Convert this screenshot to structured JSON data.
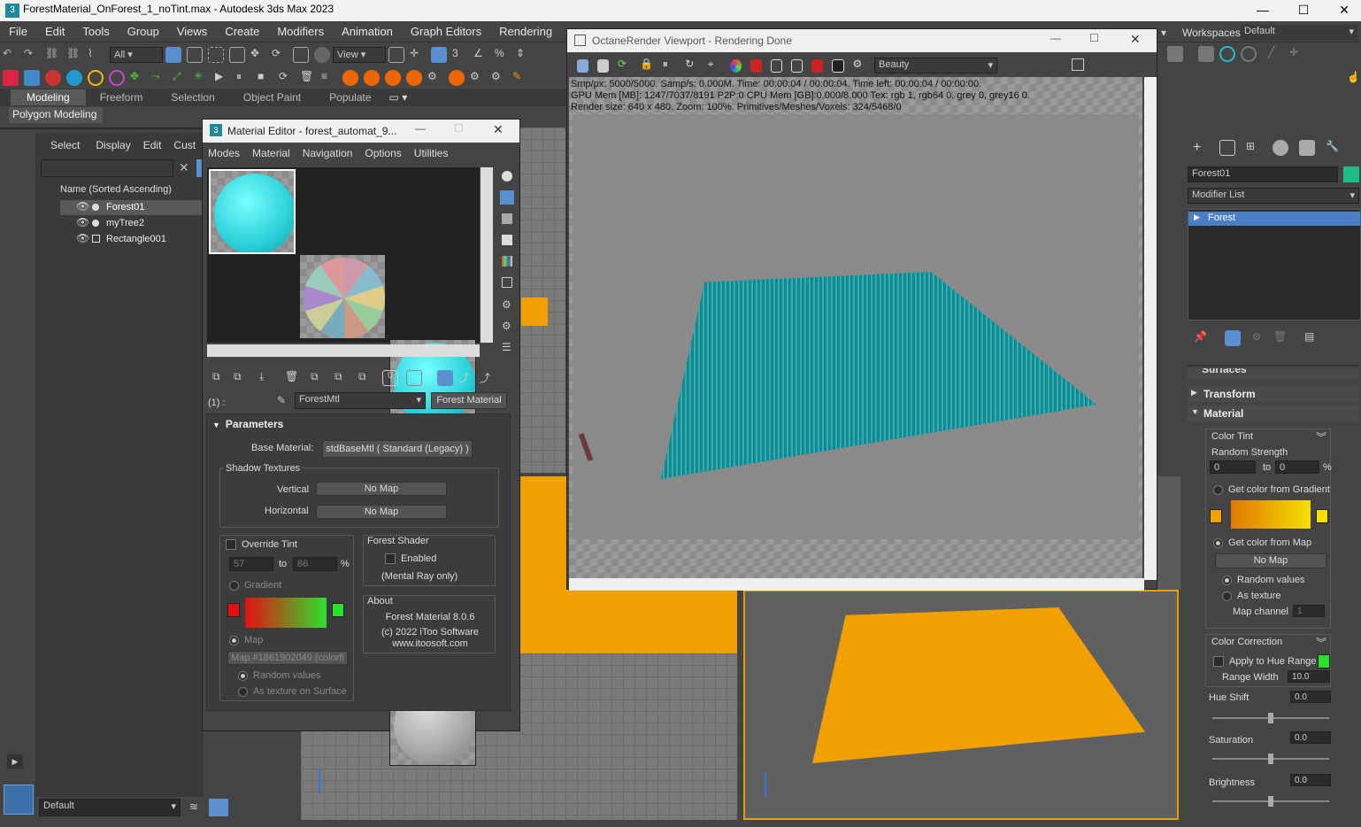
{
  "app": {
    "title": "ForestMaterial_OnForest_1_noTint.max - Autodesk 3ds Max 2023",
    "menu": [
      "File",
      "Edit",
      "Tools",
      "Group",
      "Views",
      "Create",
      "Modifiers",
      "Animation",
      "Graph Editors",
      "Rendering"
    ],
    "workspaces_label": "Workspaces:",
    "workspace_value": "Default",
    "selection_filter": "All",
    "view_dropdown": "View",
    "ribbon_tabs": [
      "Modeling",
      "Freeform",
      "Selection",
      "Object Paint",
      "Populate"
    ],
    "ribbon_sub": "Polygon Modeling"
  },
  "scene_explorer": {
    "menu": [
      "Select",
      "Display",
      "Edit",
      "Cust"
    ],
    "header": "Name (Sorted Ascending)",
    "items": [
      "Forest01",
      "myTree2",
      "Rectangle001"
    ],
    "layer": "Default"
  },
  "material_editor": {
    "title": "Material Editor - forest_automat_9...",
    "menu": [
      "Modes",
      "Material",
      "Navigation",
      "Options",
      "Utilities"
    ],
    "slot_label": "(1) :",
    "material_name": "ForestMtl",
    "material_type": "Forest Material",
    "rollout": "Parameters",
    "base_material_label": "Base Material:",
    "base_material_value": "stdBaseMtl  ( Standard (Legacy) )",
    "shadow_textures": "Shadow Textures",
    "vertical_label": "Vertical",
    "vertical_value": "No Map",
    "horizontal_label": "Horizontal",
    "horizontal_value": "No Map",
    "override_tint": "Override Tint",
    "tint_from": "57",
    "tint_to_label": "to",
    "tint_to": "86",
    "pct": "%",
    "gradient_label": "Gradient",
    "map_label": "Map",
    "map_value": "Map #1861902049 (colorfi",
    "random_values": "Random values",
    "as_texture": "As texture on Surface",
    "forest_shader": "Forest Shader",
    "enabled": "Enabled",
    "mental_ray": "(Mental Ray only)",
    "about": "About",
    "about_version": "Forest Material 8.0.6",
    "about_copy": "(c) 2022 iToo Software",
    "about_url": "www.itoosoft.com"
  },
  "octane": {
    "title": "OctaneRender Viewport - Rendering Done",
    "pass": "Beauty",
    "stats": [
      "Smp/px: 5000/5000.   Samp/s: 0.000M.   Time: 00:00:04 / 00:00:04.   Time left: 00:00:04 / 00:00:00.",
      "GPU Mem [MB]: 1247/7037/8191 P2P:0   CPU Mem [GB]:0.000/8.000   Tex: rgb 1, rgb64 0, grey 0, grey16 0.",
      "Render size: 640 x 480.   Zoom: 100%.   Primitives/Meshes/Voxels: 324/5468/0"
    ]
  },
  "modify_panel": {
    "object_name": "Forest01",
    "modifier_list": "Modifier List",
    "stack_item": "Forest",
    "surfaces": "Surfaces",
    "transform": "Transform",
    "material": "Material",
    "color_tint": "Color Tint",
    "random_strength": "Random Strength",
    "rs_from": "0",
    "rs_to_label": "to",
    "rs_to": "0",
    "pct": "%",
    "gradient_option": "Get color from Gradient",
    "map_option": "Get color from Map",
    "no_map": "No Map",
    "random_values": "Random values",
    "as_texture": "As texture",
    "map_channel": "Map channel",
    "map_channel_value": "1",
    "color_correction": "Color Correction",
    "apply_hue": "Apply to Hue Range",
    "range_width": "Range Width",
    "range_width_value": "10.0",
    "hue_shift": "Hue Shift",
    "hue_shift_value": "0.0",
    "saturation": "Saturation",
    "saturation_value": "0.0",
    "brightness": "Brightness",
    "brightness_value": "0.0"
  },
  "colors": {
    "accent": "#4a7fc7",
    "teal": "#2ab8c8",
    "orange": "#f0a000",
    "red": "#e41010",
    "green": "#2ee02e"
  }
}
